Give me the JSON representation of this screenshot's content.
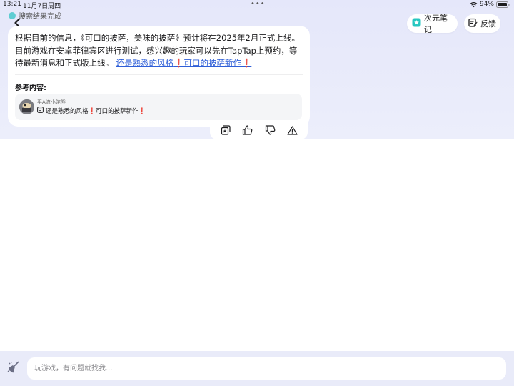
{
  "status_bar": {
    "time": "13:21",
    "date": "11月7日周四",
    "battery": "94%"
  },
  "search_status": "搜索结果完成",
  "header": {
    "notes_label": "次元笔记",
    "feedback_label": "反馈"
  },
  "answer": {
    "text": "根据目前的信息，《可口的披萨，美味的披萨》预计将在2025年2月正式上线。目前游戏在安卓菲律宾区进行测试，感兴趣的玩家可以先在TapTap上预约，等待最新消息和正式版上线。",
    "link_part1": "还是熟悉的风格",
    "link_part2": "可口的披萨新作",
    "link_mark": "❗"
  },
  "references": {
    "heading": "参考内容:",
    "items": [
      {
        "author": "平A流小碗熊",
        "title_part1": "还是熟悉的风格",
        "title_part2": "可口的披萨新作",
        "mark": "❗"
      }
    ]
  },
  "chat": {
    "placeholder": "玩游戏，有问题就找我..."
  },
  "colors": {
    "accent": "#2f5fd8",
    "alert": "#e0241b",
    "top_background": "#e5e7fa",
    "notes_icon": "#27c7c0"
  },
  "icons": [
    "back-arrow-icon",
    "notes-icon",
    "feedback-icon",
    "copy-icon",
    "thumbs-up-icon",
    "thumbs-down-icon",
    "report-icon",
    "broom-icon",
    "wifi-icon",
    "battery-icon"
  ]
}
